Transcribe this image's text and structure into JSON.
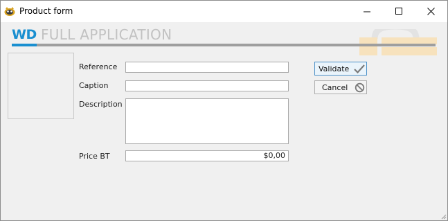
{
  "window": {
    "title": "Product form",
    "controls": {
      "minimize": "minimize-icon",
      "maximize": "maximize-icon",
      "close": "close-icon"
    }
  },
  "header": {
    "brand": "WD",
    "subtitle": "FULL APPLICATION",
    "brand_color": "#1a8fd0",
    "subtitle_color": "#c2c2c2"
  },
  "form": {
    "reference": {
      "label": "Reference",
      "value": ""
    },
    "caption": {
      "label": "Caption",
      "value": ""
    },
    "description": {
      "label": "Description",
      "value": ""
    },
    "price": {
      "label": "Price BT",
      "value": "$0,00"
    }
  },
  "buttons": {
    "validate": {
      "label": "Validate",
      "icon": "checkmark-icon"
    },
    "cancel": {
      "label": "Cancel",
      "icon": "prohibit-icon"
    }
  },
  "colors": {
    "window_background": "#f0f0f0",
    "accent": "#1a8fd0",
    "watermark": "#f5deb3"
  }
}
